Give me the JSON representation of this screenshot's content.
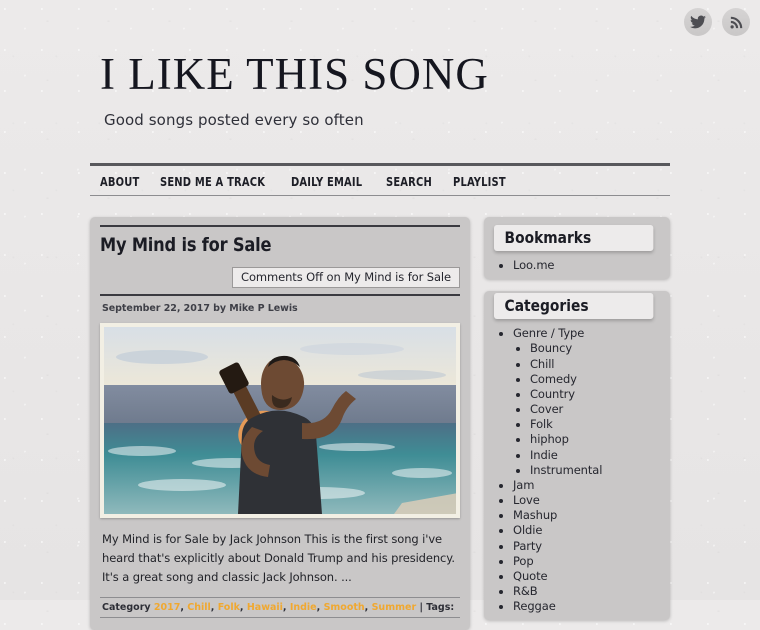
{
  "social": [
    {
      "name": "twitter-icon",
      "label": "Twitter"
    },
    {
      "name": "rss-icon",
      "label": "RSS Feed"
    }
  ],
  "header": {
    "title": "I LIKE THIS SONG",
    "description": "Good songs posted every so often"
  },
  "nav": {
    "items": [
      {
        "label": "About"
      },
      {
        "label": "Send Me a Track"
      },
      {
        "label": "Daily Email"
      },
      {
        "label": "Search"
      },
      {
        "label": "Playlist"
      }
    ]
  },
  "post": {
    "title": "My Mind is for Sale",
    "comments": "Comments Off on My Mind is for Sale",
    "date": "September 22, 2017",
    "by": "by",
    "author": "Mike P Lewis",
    "meta": "September 22, 2017 by Mike P Lewis",
    "image_alt": "Man playing acoustic guitar on a beach at sunset",
    "excerpt": "My Mind is for Sale by Jack Johnson This is the first song i've heard that's explicitly about Donald Trump and his presidency. It's a great song and classic Jack Johnson. ...",
    "footer": {
      "category_label": "Category",
      "categories": [
        "2017",
        "Chill",
        "Folk",
        "Hawaii",
        "Indie",
        "Smooth",
        "Summer"
      ],
      "separator": "|",
      "tags_label": "Tags:"
    }
  },
  "sidebar": {
    "widgets": [
      {
        "title": "Bookmarks",
        "items": [
          {
            "label": "Loo.me"
          }
        ]
      },
      {
        "title": "Categories",
        "items": [
          {
            "label": "Genre / Type",
            "children": [
              {
                "label": "Bouncy"
              },
              {
                "label": "Chill"
              },
              {
                "label": "Comedy"
              },
              {
                "label": "Country"
              },
              {
                "label": "Cover"
              },
              {
                "label": "Folk"
              },
              {
                "label": "hiphop"
              },
              {
                "label": "Indie"
              },
              {
                "label": "Instrumental"
              }
            ]
          },
          {
            "label": "Jam"
          },
          {
            "label": "Love"
          },
          {
            "label": "Mashup"
          },
          {
            "label": "Oldie"
          },
          {
            "label": "Party"
          },
          {
            "label": "Pop"
          },
          {
            "label": "Quote"
          },
          {
            "label": "R&B"
          },
          {
            "label": "Reggae"
          }
        ]
      }
    ]
  },
  "colors": {
    "link_accent": "#f0a830",
    "panel": "#c9c7c7",
    "page_bg": "#e9e7e7",
    "text": "#2b2b33"
  }
}
